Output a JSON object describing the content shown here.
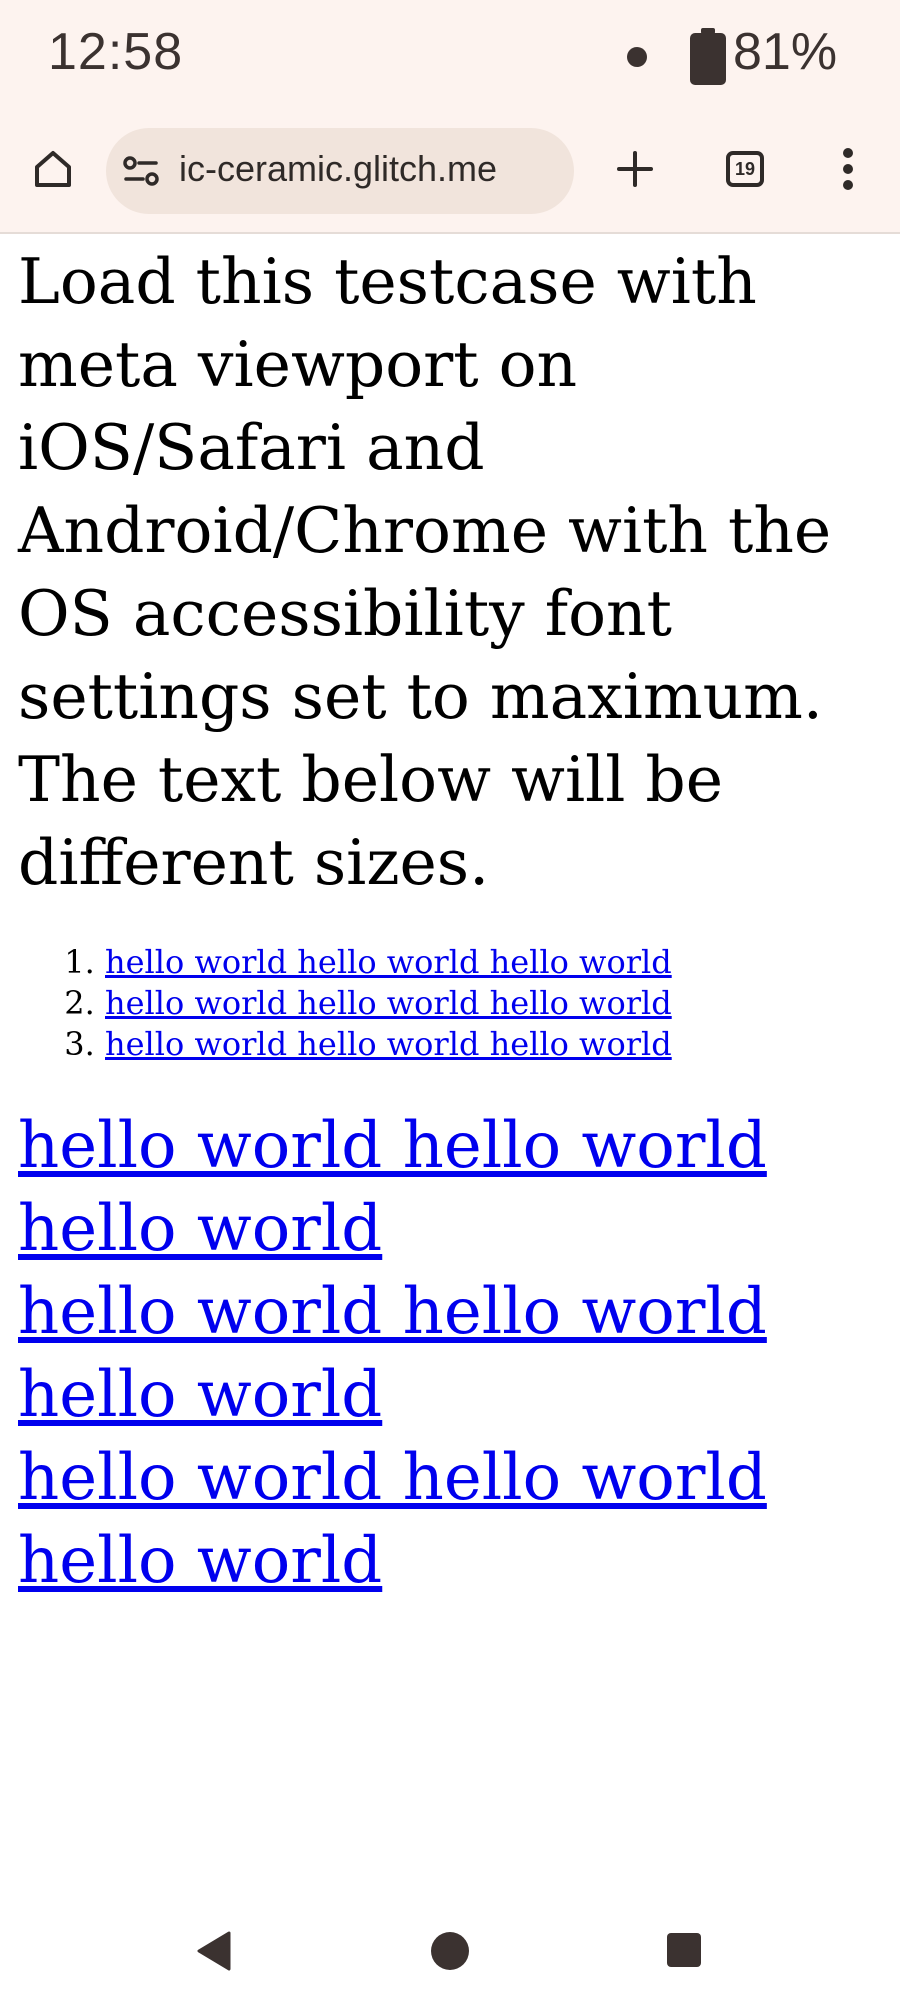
{
  "status_bar": {
    "time": "12:58",
    "battery_percent": "81%",
    "battery_icon": "battery-icon",
    "notification_icon": "dot-icon"
  },
  "toolbar": {
    "home_icon": "home-icon",
    "site_info_icon": "site-info-icon",
    "url": "ic-ceramic.glitch.me",
    "new_tab_icon": "plus-icon",
    "tab_count": "19",
    "menu_icon": "more-vert-icon"
  },
  "content": {
    "intro": "Load this testcase with meta viewport on iOS/Safari and Android/Chrome with the OS accessibility font settings set to maximum. The text below will be different sizes.",
    "small_list": [
      "hello world hello world hello world",
      "hello world hello world hello world",
      "hello world hello world hello world"
    ],
    "large_links": [
      "hello world hello world hello world",
      "hello world hello world hello world",
      "hello world hello world hello world"
    ]
  },
  "nav_bar": {
    "back_icon": "back-triangle-icon",
    "home_icon": "home-circle-icon",
    "recents_icon": "recents-square-icon"
  },
  "colors": {
    "chrome_background": "#fdf3ef",
    "url_pill": "#f1e4dc",
    "link": "#0000ee",
    "text": "#000000"
  }
}
